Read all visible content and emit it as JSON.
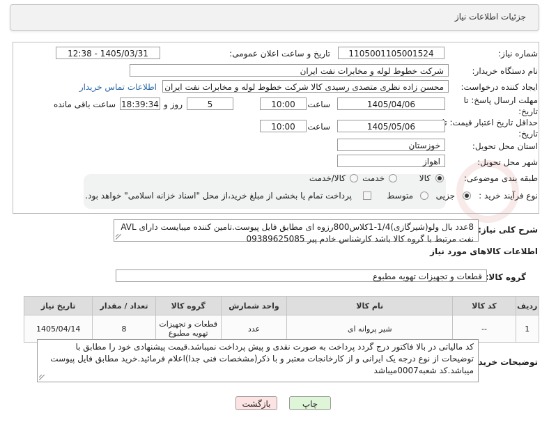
{
  "header": {
    "title": "جزئیات اطلاعات نیاز"
  },
  "fields": {
    "need_number": {
      "label": "شماره نیاز:",
      "value": "1105001105001524"
    },
    "announce_datetime": {
      "label": "تاریخ و ساعت اعلان عمومی:",
      "value": "1405/03/31 - 12:38"
    },
    "buyer_org": {
      "label": "نام دستگاه خریدار:",
      "value": "شرکت خطوط لوله و مخابرات نفت ایران"
    },
    "requester": {
      "label": "ایجاد کننده درخواست:",
      "value": "محسن زاده نظری متصدی رسیدی کالا شرکت خطوط لوله و مخابرات نفت ایران",
      "link": "اطلاعات تماس خریدار"
    },
    "reply_deadline": {
      "label": "مهلت ارسال پاسخ: تا تاریخ:",
      "date": "1405/04/06",
      "time_label": "ساعت",
      "time": "10:00",
      "days": "5",
      "days_label": "روز و",
      "remaining": "18:39:34",
      "remaining_label": "ساعت باقی مانده"
    },
    "price_validity": {
      "label": "حداقل تاریخ اعتبار قیمت: تا تاریخ:",
      "date": "1405/05/06",
      "time_label": "ساعت",
      "time": "10:00"
    },
    "delivery_province": {
      "label": "استان محل تحویل:",
      "value": "خوزستان"
    },
    "delivery_city": {
      "label": "شهر محل تحویل:",
      "value": "اهواز"
    },
    "category": {
      "label": "طبقه بندی موضوعی:",
      "options": [
        "کالا",
        "خدمت",
        "کالا/خدمت"
      ],
      "selected": "کالا"
    },
    "process_type": {
      "label": "نوع فرآیند خرید :",
      "options": [
        "جزیی",
        "متوسط"
      ],
      "selected": "جزیی",
      "payment_note": "پرداخت تمام یا بخشی از مبلغ خرید،از محل \"اسناد خزانه اسلامی\" خواهد بود."
    }
  },
  "general_desc": {
    "label": "شرح کلی نیاز:",
    "value": "8عدد بال ولو(شیرگازی)1/4-1کلاس800رزوه ای مطابق فایل پیوست.تامین کننده میبایست دارای AVL نفت مرتبط با گروه کالا باشد کارشناس خادم پیر 09389625085"
  },
  "goods_info": {
    "title": "اطلاعات کالاهای مورد نیاز",
    "group_label": "گروه کالا:",
    "group_value": "قطعات و تجهیزات تهویه مطبوع"
  },
  "table": {
    "headers": [
      "ردیف",
      "کد کالا",
      "نام کالا",
      "واحد شمارش",
      "گروه کالا",
      "تعداد / مقدار",
      "تاریخ نیاز"
    ],
    "rows": [
      [
        "1",
        "--",
        "شیر پروانه ای",
        "عدد",
        "قطعات و تجهیزات تهویه مطبوع",
        "8",
        "1405/04/14"
      ]
    ]
  },
  "buyer_notes": {
    "label": "توضیحات خریدار:",
    "value": "کد مالیاتی در بالا فاکتور درج گردد پرداخت به صورت نقدی و پیش پرداخت نمیباشد.قیمت پیشنهادی خود را مطابق با توضیحات از نوع درجه یک ایرانی و از کارخانجات معتبر و با ذکر(مشخصات فنی جدا)اعلام فرمائید.خرید مطابق فایل پیوست میباشد.کد شعبه0007میباشد"
  },
  "buttons": {
    "print": "چاپ",
    "back": "بازگشت"
  },
  "colors": {
    "link": "#2e6aa8",
    "print_bg": "#dff5d8",
    "back_bg": "#fde3e3"
  }
}
